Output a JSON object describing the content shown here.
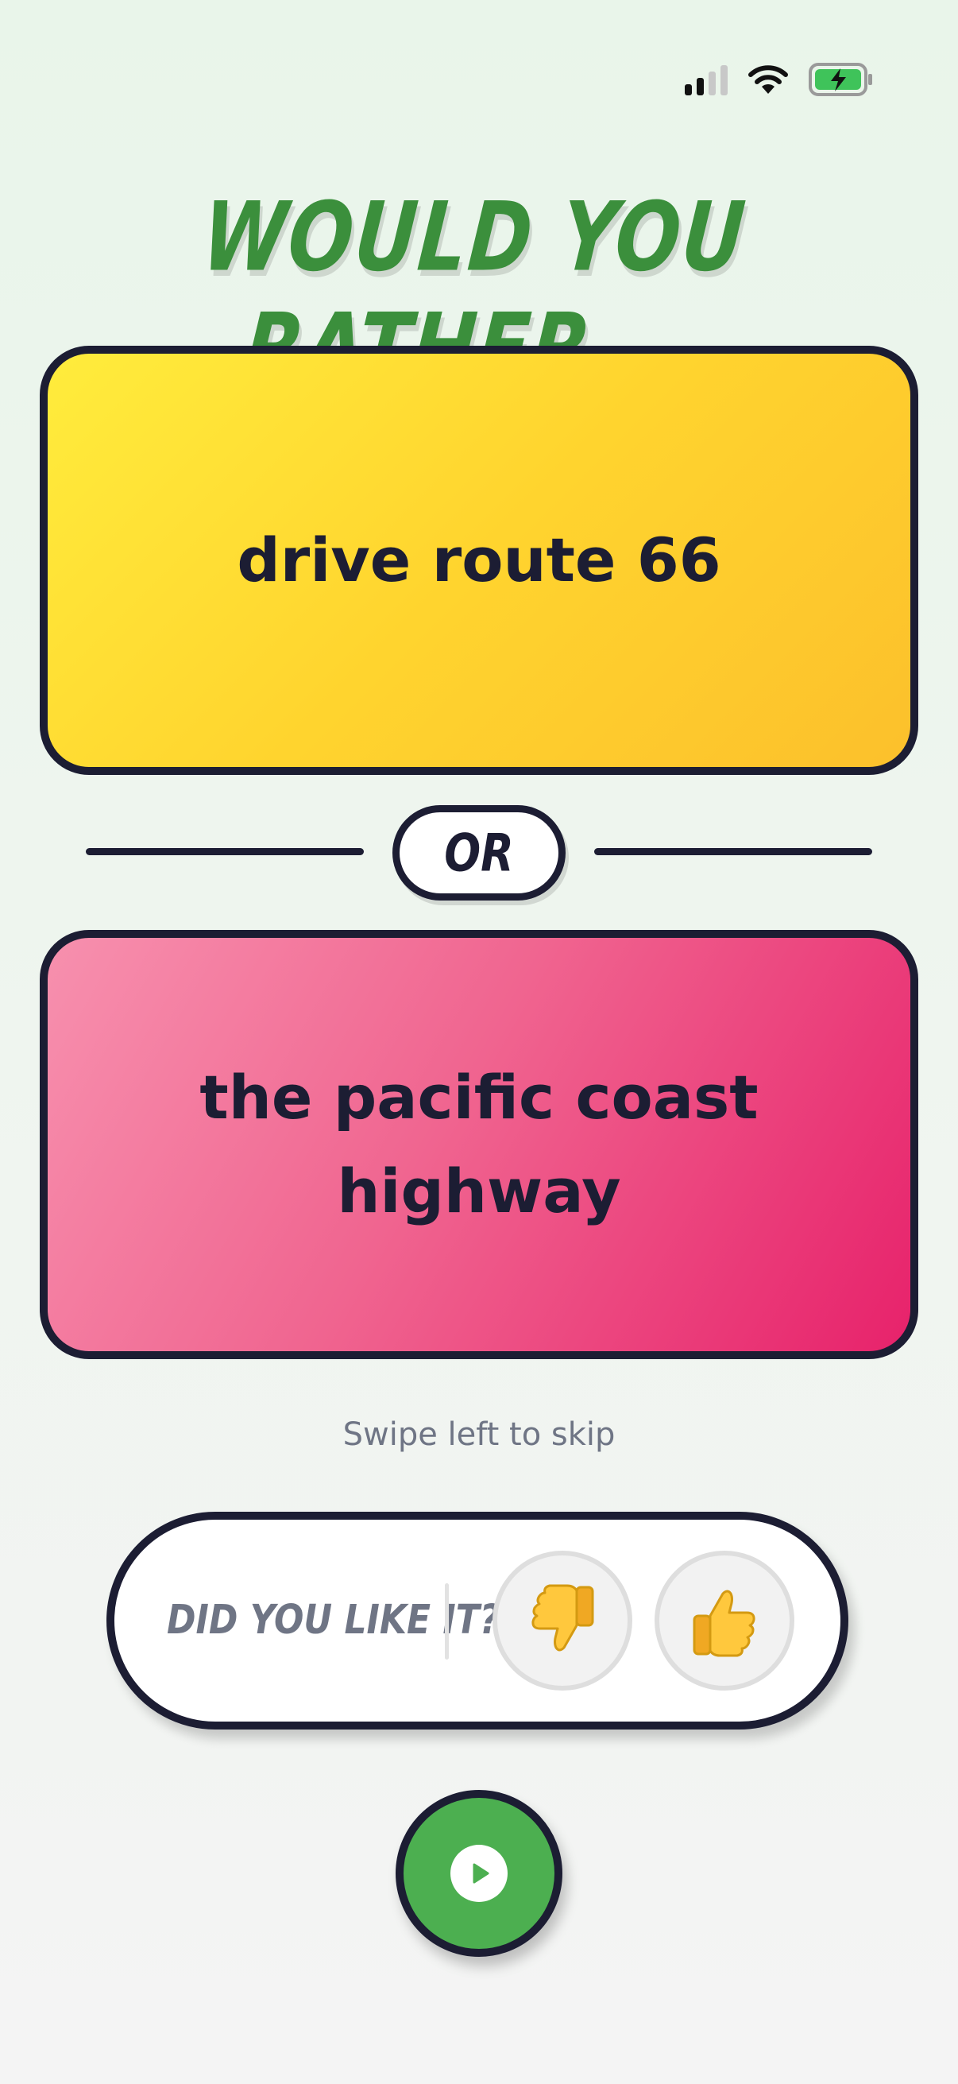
{
  "status_bar": {
    "signal_icon": "cellular-signal-icon",
    "wifi_icon": "wifi-icon",
    "battery_icon": "battery-charging-icon",
    "signal_bars_active": 2,
    "signal_bars_total": 4
  },
  "title": "WOULD YOU RATHER...",
  "option_a": {
    "text": "drive route 66",
    "colors": [
      "#ffec3c",
      "#fcc02c"
    ]
  },
  "divider": {
    "label": "OR"
  },
  "option_b": {
    "text": "the pacific coast highway",
    "colors": [
      "#f790ae",
      "#e7226b"
    ]
  },
  "hint": "Swipe left to skip",
  "feedback": {
    "label": "DID YOU LIKE IT?",
    "dislike_icon": "thumbs-down-icon",
    "like_icon": "thumbs-up-icon"
  },
  "play_button": {
    "icon": "play-icon",
    "color": "#4caf50"
  },
  "colors": {
    "title": "#3b8f3c",
    "outline": "#1c1d33",
    "muted_text": "#6f7585"
  }
}
